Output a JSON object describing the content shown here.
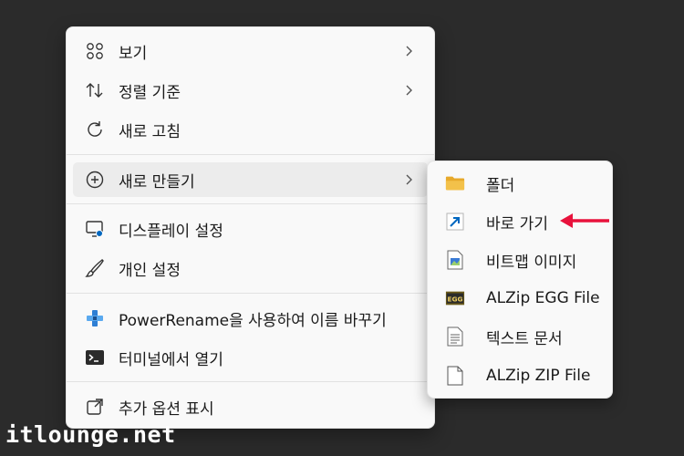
{
  "context_menu": {
    "items": [
      {
        "label": "보기",
        "icon": "grid-view-icon",
        "has_submenu": true
      },
      {
        "label": "정렬 기준",
        "icon": "sort-icon",
        "has_submenu": true
      },
      {
        "label": "새로 고침",
        "icon": "refresh-icon",
        "has_submenu": false
      },
      {
        "label": "새로 만들기",
        "icon": "add-circle-icon",
        "has_submenu": true
      },
      {
        "label": "디스플레이 설정",
        "icon": "display-settings-icon",
        "has_submenu": false
      },
      {
        "label": "개인 설정",
        "icon": "brush-icon",
        "has_submenu": false
      },
      {
        "label": "PowerRename을 사용하여 이름 바꾸기",
        "icon": "power-rename-icon",
        "has_submenu": false
      },
      {
        "label": "터미널에서 열기",
        "icon": "terminal-icon",
        "has_submenu": false
      },
      {
        "label": "추가 옵션 표시",
        "icon": "open-external-icon",
        "has_submenu": false
      }
    ]
  },
  "submenu": {
    "items": [
      {
        "label": "폴더",
        "icon": "folder-icon"
      },
      {
        "label": "바로 가기",
        "icon": "shortcut-icon"
      },
      {
        "label": "비트맵 이미지",
        "icon": "bitmap-file-icon"
      },
      {
        "label": "ALZip EGG File",
        "icon": "egg-archive-icon"
      },
      {
        "label": "텍스트 문서",
        "icon": "text-document-icon"
      },
      {
        "label": "ALZip ZIP File",
        "icon": "blank-file-icon"
      }
    ]
  },
  "annotation": {
    "color": "#e8123c",
    "points_to": "바로 가기"
  },
  "watermark": "itlounge.net",
  "colors": {
    "background": "#2b2b2b",
    "menu": "#f9f9f9",
    "accent": "#0067c0",
    "folder": "#f3c14a"
  }
}
